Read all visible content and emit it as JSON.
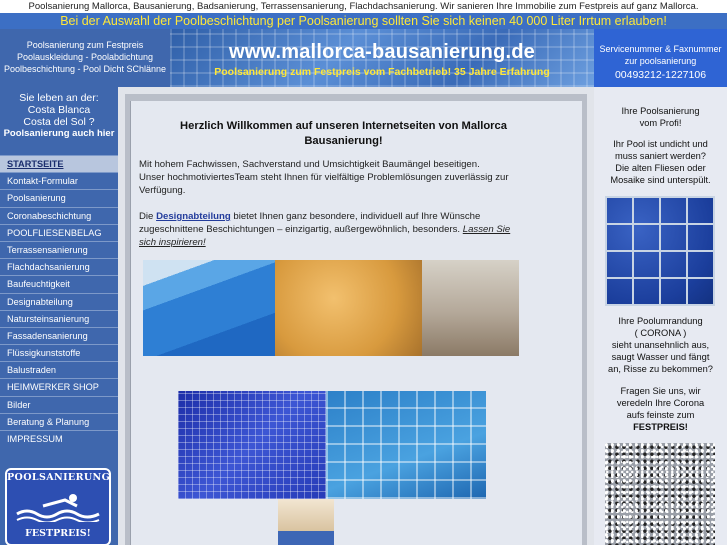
{
  "top_keywords": "Poolsanierung Mallorca, Bausanierung, Badsanierung, Terrassensanierung, Flachdachsanierung. Wir sanieren Ihre Immobilie zum Festpreis auf ganz Mallorca.",
  "banner_text": "Bei der Auswahl der Poolbeschichtung per Poolsanierung sollten Sie sich keinen 40 000 Liter Irrtum erlauben!",
  "left_header": {
    "line1": "Poolsanierung zum Festpreis",
    "line2": "Poolauskleidung - Poolabdichtung",
    "line3": "Poolbeschichtung - Pool Dicht SChlänne"
  },
  "site": {
    "url": "www.mallorca-bausanierung.de",
    "subtitle": "Poolsanierung zum Festpreis vom Fachbetrieb! 35 Jahre Erfahrung"
  },
  "service": {
    "line1": "Servicenummer & Faxnummer",
    "line2": "zur poolsanierung",
    "phone": "00493212-1227106"
  },
  "location": {
    "line1": "Sie leben an der:",
    "line2": "Costa Blanca",
    "line3": "Costa del Sol ?",
    "line4": "Poolsanierung auch hier"
  },
  "nav": [
    "STARTSEITE",
    "Kontakt-Formular",
    "Poolsanierung",
    "Coronabeschichtung",
    "POOLFLIESENBELAG",
    "Terrassensanierung",
    "Flachdachsanierung",
    "Baufeuchtigkeit",
    "Designabteilung",
    "Natursteinsanierung",
    "Fassadensanierung",
    "Flüssigkunststoffe",
    "Balustraden",
    "HEIMWERKER SHOP",
    "Bilder",
    "Beratung & Planung",
    "IMPRESSUM"
  ],
  "logo": {
    "top": "POOLSANIERUNG",
    "bottom": "FESTPREIS!"
  },
  "main": {
    "title": "Herzlich Willkommen auf unseren Internetseiten von Mallorca Bausanierung!",
    "para1": "Mit hohem Fachwissen, Sachverstand und Umsichtigkeit Baumängel beseitigen.",
    "para2": "Unser hochmotiviertesTeam steht Ihnen für vielfältige Problemlösungen zuverlässig zur Verfügung.",
    "para3_pre": "Die",
    "para3_link": "Designabteilung",
    "para3_mid": "bietet Ihnen ganz besondere, individuell auf Ihre Wünsche zugeschnittene Beschichtungen – einzigartig, außergewöhnlich, besonders.",
    "para3_link2": "Lassen Sie sich inspirieren!"
  },
  "right": {
    "b1_l1": "Ihre Poolsanierung",
    "b1_l2": "vom Profi!",
    "b2_l1": "Ihr Pool ist undicht und",
    "b2_l2": "muss saniert werden?",
    "b2_l3": "Die alten Fliesen oder",
    "b2_l4": "Mosaike sind unterspült.",
    "b3_l1": "Ihre Poolumrandung",
    "b3_l2": "( CORONA )",
    "b3_l3": "sieht unansehnlich aus,",
    "b3_l4": "saugt Wasser und fängt",
    "b3_l5": "an, Risse zu bekommen?",
    "b4_l1": "Fragen Sie uns, wir",
    "b4_l2": "veredeln Ihre Corona",
    "b4_l3": "aufs feinste zum",
    "b4_l4": "FESTPREIS!"
  },
  "colors": {
    "banner_bg": "#3c6fc4",
    "banner_text": "#ffe838",
    "nav_bg": "#3f67ad",
    "phone_bg": "#2f64d4"
  }
}
